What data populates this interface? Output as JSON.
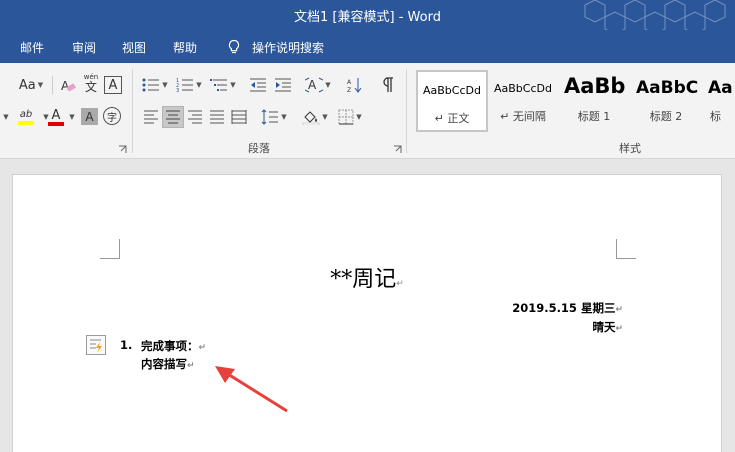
{
  "window": {
    "title": "文档1 [兼容模式]  -  Word"
  },
  "tabs": [
    {
      "label": "邮件"
    },
    {
      "label": "审阅"
    },
    {
      "label": "视图"
    },
    {
      "label": "帮助"
    }
  ],
  "tell_me": {
    "label": "操作说明搜索",
    "icon": "lightbulb-icon"
  },
  "font_group": {
    "change_case_label": "Aa",
    "phonetic_label": "wén",
    "phonetic_char": "文",
    "char_border_label": "A",
    "highlight_label": "ab",
    "font_color_label": "A",
    "char_shading_label": "A",
    "enclose_label": "字"
  },
  "paragraph_group": {
    "label": "段落"
  },
  "styles_group": {
    "label": "样式",
    "styles": [
      {
        "sample": "AaBbCcDd",
        "name": "↵ 正文",
        "active": true
      },
      {
        "sample": "AaBbCcDd",
        "name": "↵ 无间隔",
        "active": false
      },
      {
        "sample": "AaBb",
        "name": "标题 1",
        "active": false
      },
      {
        "sample": "AaBbC",
        "name": "标题 2",
        "active": false
      },
      {
        "sample": "Aa",
        "name": "标",
        "active": false
      }
    ]
  },
  "document": {
    "title": "**周记",
    "date": "2019.5.15  星期三",
    "weather": "晴天",
    "list_number": "1.",
    "list_item": "完成事项：",
    "list_sub": "内容描写",
    "paragraph_mark": "↵"
  },
  "colors": {
    "title_bar": "#2b579a",
    "ribbon": "#f3f3f3",
    "highlight_yellow": "#ffff00",
    "font_red": "#e00000",
    "annotation_arrow": "#e8413b"
  }
}
